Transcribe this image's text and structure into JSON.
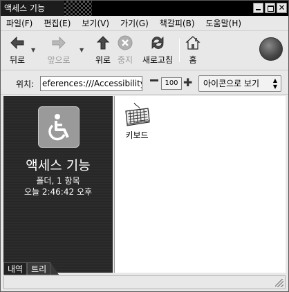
{
  "window": {
    "title": "액세스 기능"
  },
  "menu": [
    "파일(F)",
    "편집(E)",
    "보기(V)",
    "가기(G)",
    "책갈피(B)",
    "도움말(H)"
  ],
  "toolbar": {
    "back": "뒤로",
    "forward": "앞으로",
    "up": "위로",
    "stop": "중지",
    "reload": "새로고침",
    "home": "홈"
  },
  "location": {
    "label": "위치:",
    "value": "eferences:///Accessibility",
    "zoom": "100",
    "view_mode": "아이콘으로 보기"
  },
  "sidebar": {
    "title": "액세스 기능",
    "info_line1": "폴더, 1 항목",
    "info_line2": "오늘 2:46:42 오후",
    "tabs": [
      "내역",
      "트리"
    ]
  },
  "content": {
    "items": [
      {
        "label": "키보드",
        "icon": "keyboard-icon"
      }
    ]
  },
  "colors": {
    "titlebar": "#000000",
    "sidepane": "#2a2a2a",
    "window_bg": "#e8e8e8"
  }
}
